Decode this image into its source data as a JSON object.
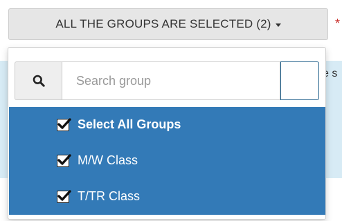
{
  "dropdown": {
    "button_label": "ALL THE GROUPS ARE SELECTED (2)",
    "required_marker": "*",
    "search": {
      "placeholder": "Search group",
      "value": "",
      "icon": "search-icon"
    },
    "options": [
      {
        "label": "Select All Groups",
        "checked": true
      },
      {
        "label": "M/W Class",
        "checked": true
      },
      {
        "label": "T/TR Class",
        "checked": true
      }
    ]
  },
  "background": {
    "banner_fragment": "e s"
  },
  "colors": {
    "selected_bg": "#337ab7",
    "button_bg": "#e6e6e6",
    "required": "#c9302c"
  }
}
